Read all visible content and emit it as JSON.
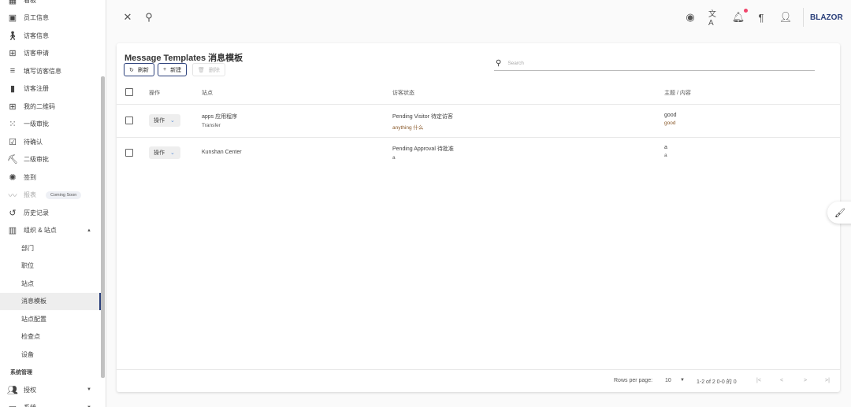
{
  "sidebar": {
    "items": [
      {
        "label": "看板",
        "icon": "dashboard-icon"
      },
      {
        "label": "员工信息",
        "icon": "badge-icon"
      },
      {
        "label": "访客信息",
        "icon": "walk-icon"
      },
      {
        "label": "访客申请",
        "icon": "post-add-icon"
      },
      {
        "label": "填写访客信息",
        "icon": "edit-note-icon"
      },
      {
        "label": "访客注册",
        "icon": "book-icon"
      },
      {
        "label": "我的二维码",
        "icon": "qr-code-icon"
      },
      {
        "label": "一级审批",
        "icon": "approval-icon"
      },
      {
        "label": "待确认",
        "icon": "checklist-icon"
      },
      {
        "label": "二级审批",
        "icon": "hiking-icon"
      },
      {
        "label": "签到",
        "icon": "camera-shutter-icon"
      },
      {
        "label": "报表",
        "icon": "chart-icon",
        "badge": "Coming Soon"
      },
      {
        "label": "历史记录",
        "icon": "history-icon"
      },
      {
        "label": "组织 & 站点",
        "icon": "domain-icon"
      }
    ],
    "sub_items": [
      "部门",
      "职位",
      "站点",
      "消息模板",
      "站点配置",
      "检查点",
      "设备"
    ],
    "section": "系统管理",
    "bottom_items": [
      {
        "label": "授权",
        "icon": "manage-accounts-icon"
      },
      {
        "label": "系统",
        "icon": "settings-window-icon"
      }
    ]
  },
  "topbar": {
    "brand": "BLAZOR"
  },
  "page": {
    "title": "Message Templates 消息模板",
    "refresh": "刷新",
    "new": "新建",
    "delete": "删除",
    "search_placeholder": "Search",
    "columns": [
      "操作",
      "站点",
      "访客状态",
      "主题 / 内容"
    ],
    "rows": [
      {
        "action": "操作",
        "site": "apps 应用程序",
        "site2": "Transfer",
        "status": "Pending Visitor 待定访客",
        "status2": "anything 什么",
        "subject": "good",
        "content": "good"
      },
      {
        "action": "操作",
        "site": "Kunshan Center",
        "site2": "",
        "status": "Pending Approval 待批准",
        "status2": "a",
        "subject": "a",
        "content": "a"
      }
    ],
    "rows_per_page_label": "Rows per page:",
    "rows_per_page": "10",
    "range": "1-2 of 2 0-0 的 0"
  }
}
